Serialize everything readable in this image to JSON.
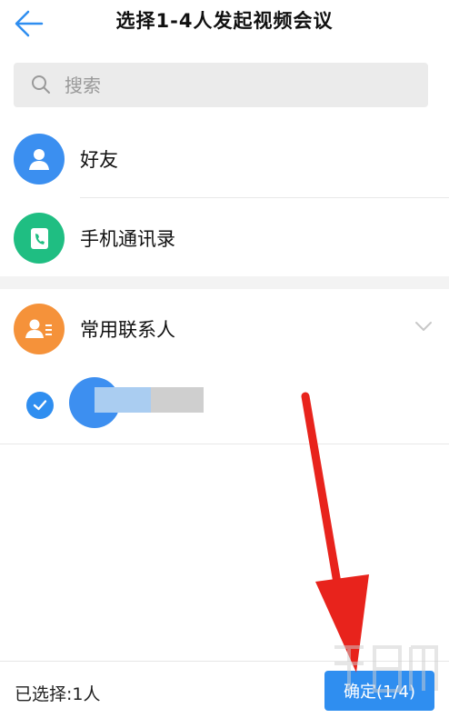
{
  "header": {
    "title": "选择1-4人发起视频会议"
  },
  "search": {
    "placeholder": "搜索"
  },
  "list": [
    {
      "label": "好友",
      "icon": "person-icon",
      "color": "#3b8ff0"
    },
    {
      "label": "手机通讯录",
      "icon": "phonebook-icon",
      "color": "#1fbe82"
    },
    {
      "label": "常用联系人",
      "icon": "contact-card-icon",
      "color": "#f5923a"
    }
  ],
  "footer": {
    "selected": "已选择:1人",
    "confirm": "确定(1/4)"
  },
  "colors": {
    "accent": "#2f8ef0",
    "annotation_arrow": "#e8231c"
  }
}
